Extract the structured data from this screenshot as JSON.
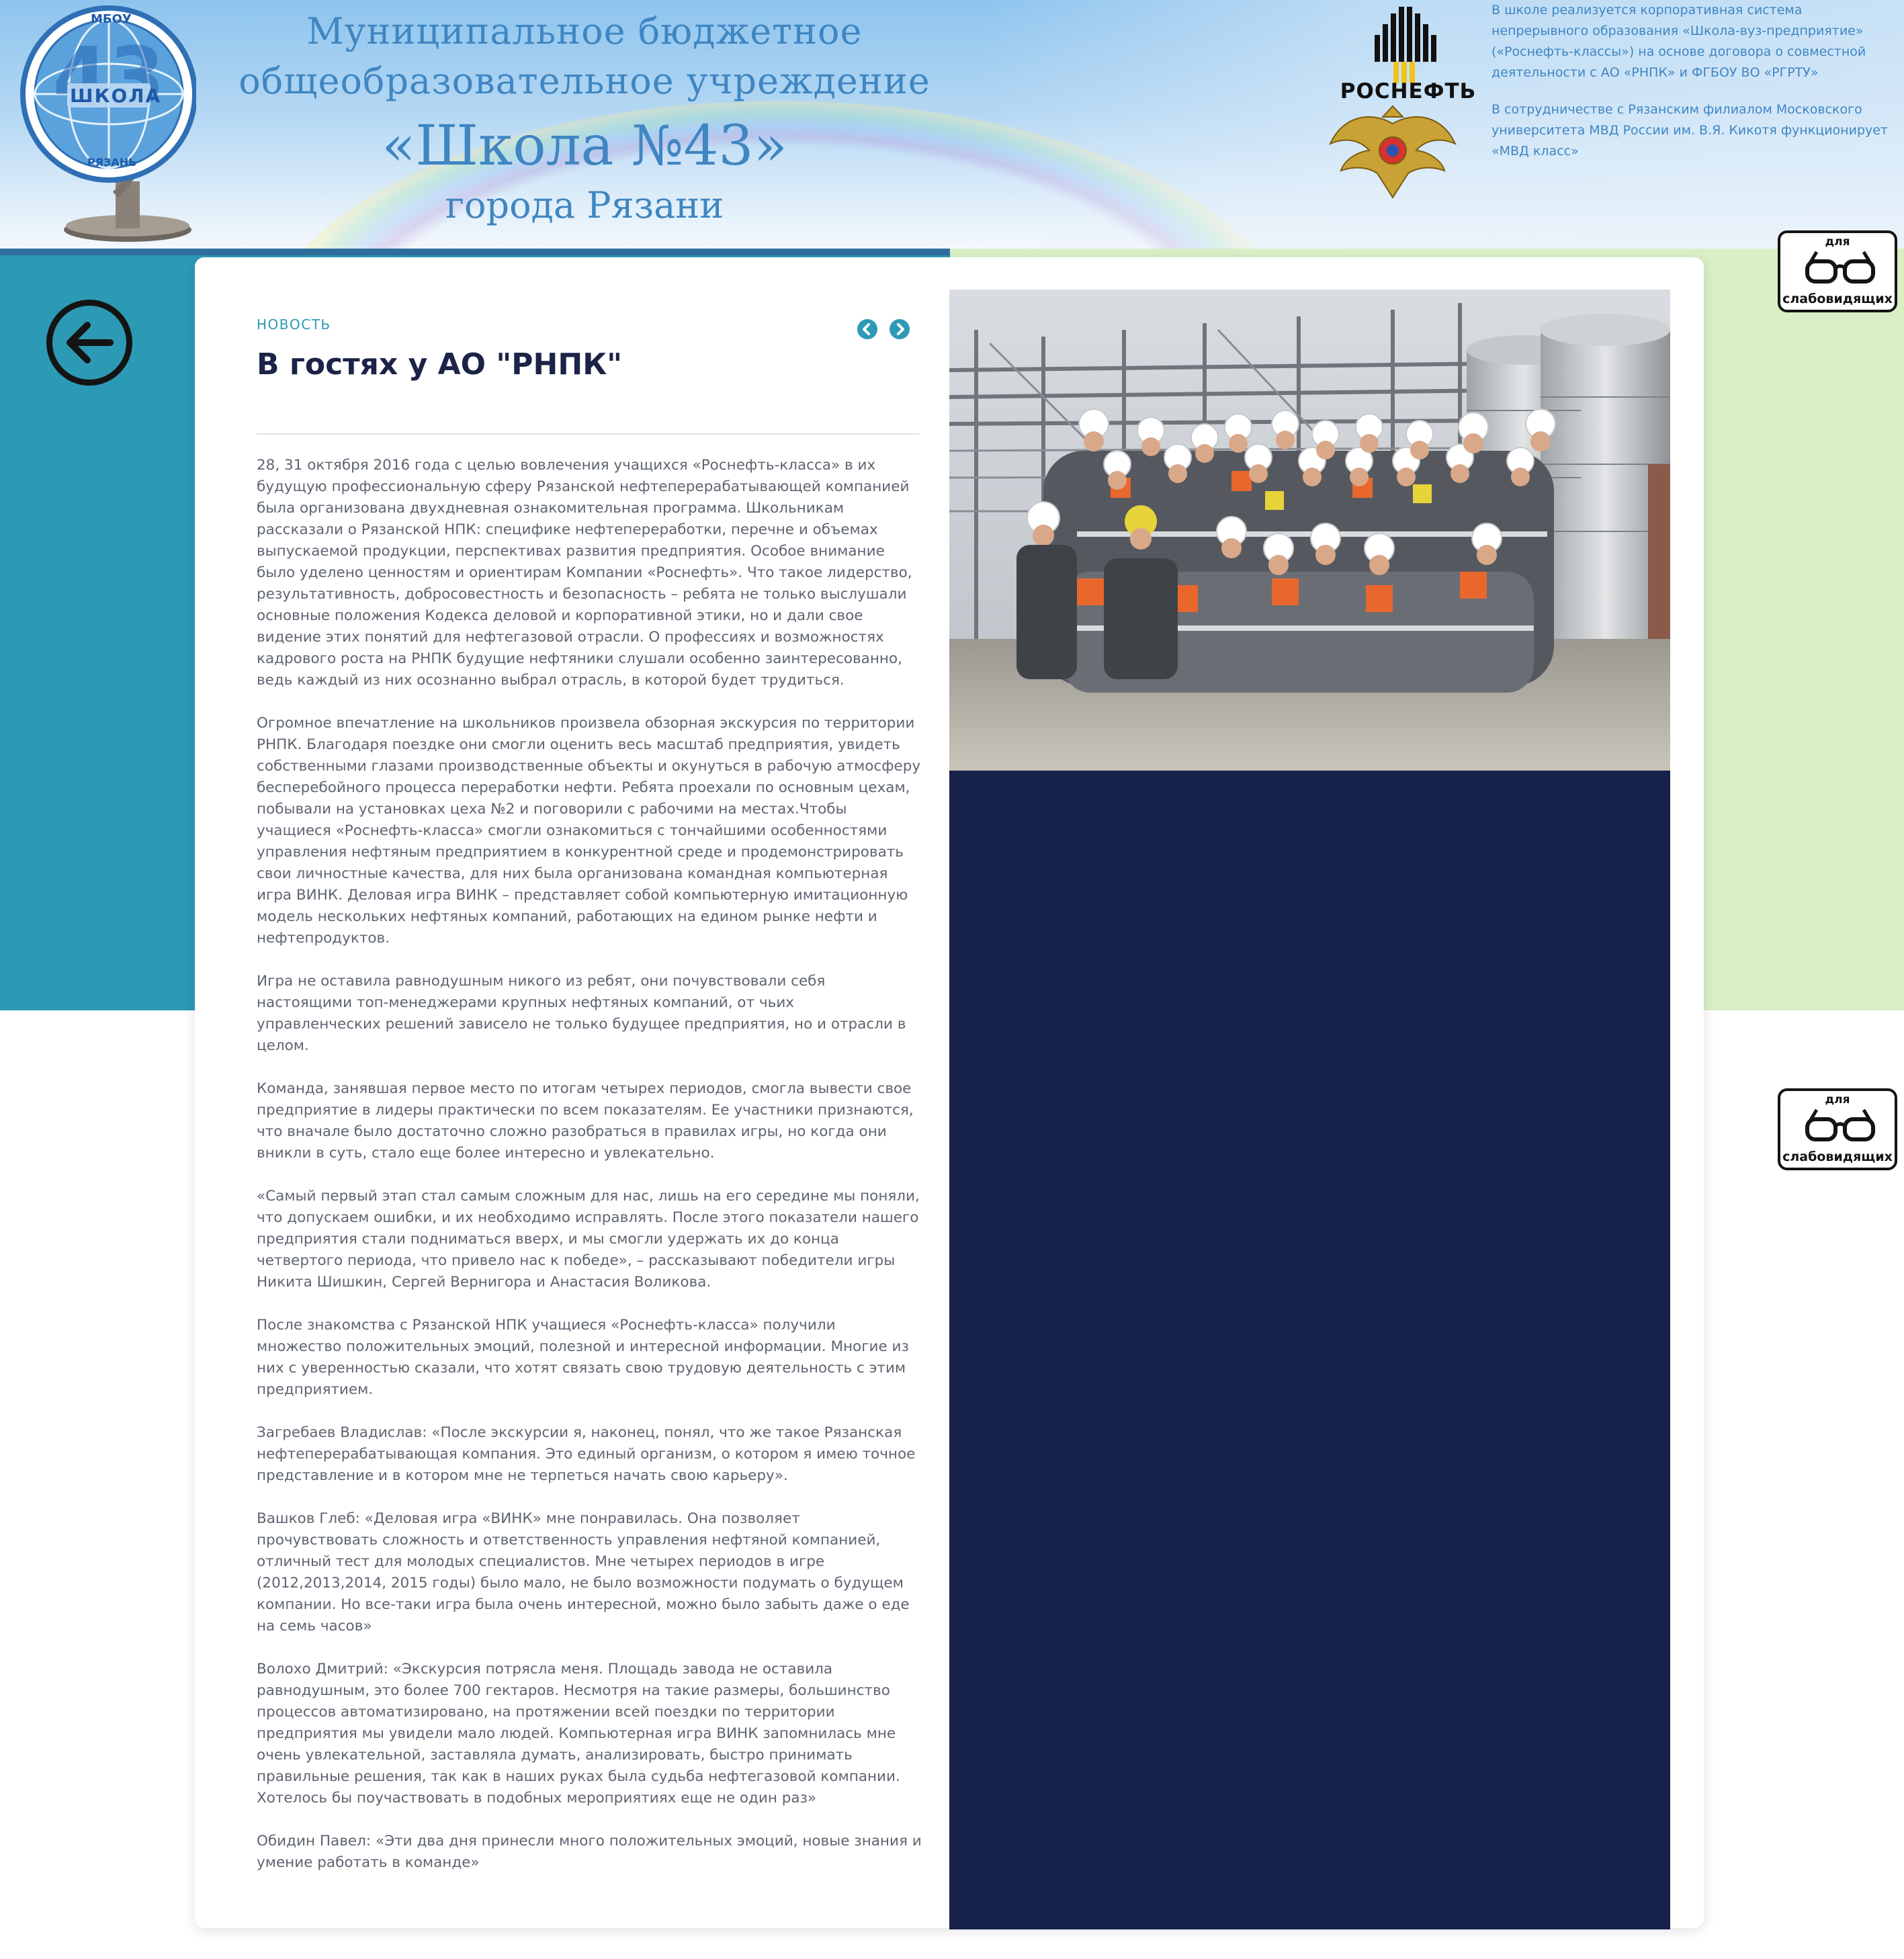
{
  "header": {
    "logo": {
      "top_text": "МБОУ",
      "center_text": "ШКОЛА",
      "number": "43",
      "bottom_text": "РЯЗАНЬ"
    },
    "title_line1": "Муниципальное бюджетное",
    "title_line2": "общеобразовательное учреждение",
    "title_line3": "«Школа №43»",
    "title_line4": "города Рязани",
    "partner_logo": "РОСНЕФТЬ",
    "info_paragraph_1": "В школе реализуется корпоративная система непрерывного образования «Школа-вуз-предприятие» («Роснефть-классы») на основе договора о совместной деятельности с АО «РНПК» и ФГБОУ ВО «РГРТУ»",
    "info_paragraph_2": "В сотрудничестве с Рязанским филиалом Московского университета МВД России им. В.Я. Кикотя функционирует «МВД класс»"
  },
  "accessibility": {
    "top_label": "для",
    "bottom_label": "слабовидящих",
    "icon": "glasses-icon"
  },
  "navigation": {
    "back_icon": "arrow-left-icon",
    "prev_icon": "chevron-left-icon",
    "next_icon": "chevron-right-icon"
  },
  "article": {
    "category": "НОВОСТЬ",
    "title": "В гостях у АО \"РНПК\"",
    "paragraphs": [
      "28, 31 октября 2016 года с целью вовлечения учащихся «Роснефть-класса» в их будущую профессиональную сферу Рязанской нефтеперерабатывающей компанией  была организована двухдневная ознакомительная программа. Школьникам рассказали о Рязанской НПК: специфике нефтепереработки, перечне и объемах выпускаемой продукции, перспективах развития предприятия. Особое внимание было уделено ценностям и ориентирам Компании «Роснефть». Что такое лидерство, результативность, добросовестность и безопасность – ребята не только выслушали основные положения Кодекса деловой и корпоративной этики, но и дали свое видение этих понятий для нефтегазовой отрасли. О профессиях и возможностях кадрового роста на РНПК будущие нефтяники слушали особенно заинтересованно, ведь каждый из них осознанно выбрал отрасль, в которой будет трудиться.",
      "Огромное впечатление на школьников произвела обзорная экскурсия по территории РНПК. Благодаря поездке они смогли оценить весь масштаб предприятия, увидеть собственными глазами производственные объекты и окунуться в рабочую атмосферу бесперебойного процесса переработки нефти. Ребята проехали по основным цехам, побывали на установках цеха №2 и поговорили с рабочими на местах.Чтобы учащиеся «Роснефть-класса» смогли ознакомиться с тончайшими особенностями управления нефтяным предприятием в конкурентной среде и продемонстрировать свои личностные качества, для них была организована командная компьютерная игра ВИНК. Деловая игра ВИНК – представляет собой компьютерную имитационную модель нескольких нефтяных компаний, работающих на едином рынке нефти и нефтепродуктов.",
      " Игра не оставила равнодушным никого из ребят, они почувствовали себя настоящими топ-менеджерами крупных нефтяных компаний, от чьих управленческих решений зависело не только будущее предприятия, но и отрасли в целом.",
      " Команда, занявшая первое место по итогам четырех периодов, смогла вывести свое предприятие в лидеры практически по всем показателям. Ее участники признаются, что вначале было достаточно сложно разобраться в правилах игры, но когда они вникли в суть, стало еще более интересно и увлекательно.",
      " «Самый первый этап стал самым сложным для нас, лишь на его середине мы поняли, что допускаем ошибки, и их необходимо исправлять. После этого показатели нашего предприятия стали подниматься вверх, и мы смогли удержать их до конца четвертого периода, что привело нас к победе», – рассказывают победители игры Никита Шишкин, Сергей Вернигора и Анастасия Воликова.",
      "После знакомства с Рязанской НПК учащиеся «Роснефть-класса» получили  множество положительных эмоций, полезной и интересной информации. Многие из них с уверенностью сказали, что хотят связать свою трудовую деятельность с этим предприятием.",
      " Загребаев Владислав: «После экскурсии я, наконец, понял, что же такое Рязанская нефтеперерабатывающая компания. Это единый организм, о котором я имею точное представление и в котором  мне не терпеться начать свою карьеру».",
      " Вашков Глеб: «Деловая игра «ВИНК» мне понравилась. Она позволяет прочувствовать сложность и ответственность управления нефтяной компанией, отличный тест для молодых специалистов. Мне четырех периодов в игре (2012,2013,2014, 2015 годы) было мало, не было возможности подумать о будущем компании. Но все-таки игра была очень интересной, можно было забыть даже о еде на семь часов»",
      " Волохо Дмитрий: «Экскурсия потрясла меня. Площадь завода не оставила равнодушным, это более 700 гектаров. Несмотря на такие размеры, большинство процессов автоматизировано, на протяжении всей поездки по территории предприятия мы увидели мало людей. Компьютерная игра ВИНК запомнилась мне очень увлекательной, заставляла думать, анализировать, быстро принимать правильные решения, так как в наших руках была судьба нефтегазовой компании. Хотелось бы поучаствовать в подобных мероприятиях еще не один раз»",
      " Обидин Павел: «Эти два дня принесли много положительных эмоций, новые знания и умение работать в команде»"
    ]
  },
  "colors": {
    "teal": "#2d9ab5",
    "navy": "#16224a",
    "light_green": "#d9f0c7",
    "header_blue": "#3f86c2",
    "body_text": "#5e6470"
  }
}
